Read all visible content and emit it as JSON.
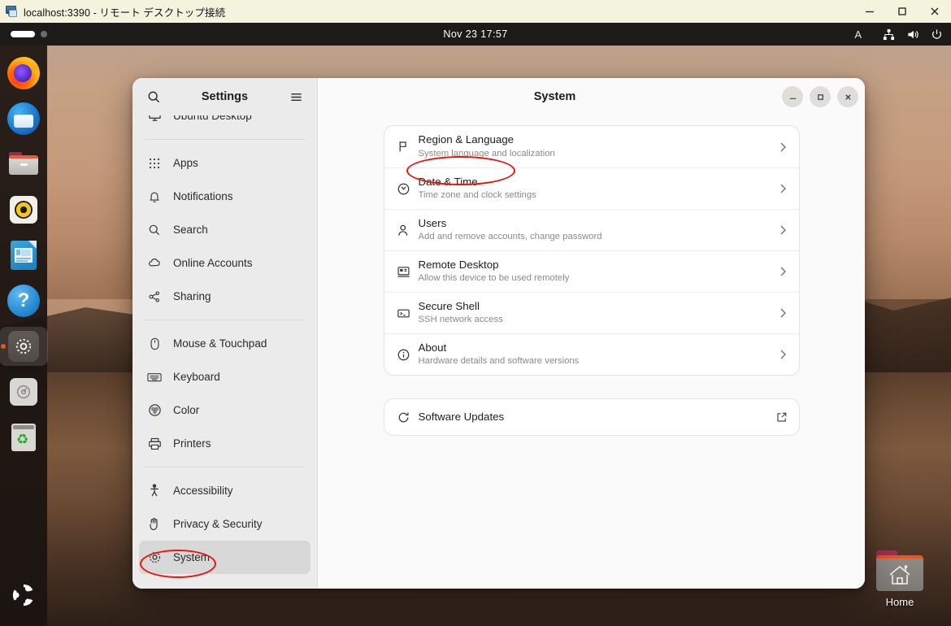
{
  "rdp": {
    "title": "localhost:3390 - リモート デスクトップ接続",
    "icon": "remote-desktop-icon",
    "controls": [
      {
        "name": "minimize",
        "label": "—"
      },
      {
        "name": "maximize",
        "label": "□"
      },
      {
        "name": "close",
        "label": "✕"
      }
    ]
  },
  "topbar": {
    "clock": "Nov 23  17:57",
    "a11y_label": "A",
    "tray_icons": [
      "network-icon",
      "volume-icon",
      "power-icon"
    ]
  },
  "dock": {
    "items": [
      {
        "label": "Firefox",
        "icon": "firefox-icon",
        "active": false
      },
      {
        "label": "Thunderbird Mail",
        "icon": "thunderbird-icon",
        "active": false
      },
      {
        "label": "Files",
        "icon": "files-icon",
        "active": false
      },
      {
        "label": "Rhythmbox",
        "icon": "rhythmbox-icon",
        "active": false
      },
      {
        "label": "LibreOffice Impress",
        "icon": "libreoffice-impress-icon",
        "active": false
      },
      {
        "label": "Help",
        "icon": "help-icon",
        "active": false
      },
      {
        "label": "Settings",
        "icon": "settings-icon",
        "active": true
      },
      {
        "label": "Disk Usage Analyzer",
        "icon": "disk-usage-icon",
        "active": false
      },
      {
        "label": "Trash",
        "icon": "trash-icon",
        "active": false
      }
    ],
    "show_apps_label": "Show Applications",
    "show_apps_icon": "ubuntu-logo-icon"
  },
  "desktop": {
    "home_icon": {
      "label": "Home",
      "icon": "home-folder-icon"
    }
  },
  "settings": {
    "sidebar": {
      "title": "Settings",
      "search_icon": "search-icon",
      "menu_icon": "hamburger-menu-icon",
      "items": [
        {
          "label": "Ubuntu Desktop",
          "icon": "ubuntu-desktop-icon",
          "selected": false,
          "clipped": true
        },
        {
          "label": "Apps",
          "icon": "apps-grid-icon",
          "selected": false
        },
        {
          "label": "Notifications",
          "icon": "bell-icon",
          "selected": false
        },
        {
          "label": "Search",
          "icon": "search-icon",
          "selected": false
        },
        {
          "label": "Online Accounts",
          "icon": "cloud-icon",
          "selected": false
        },
        {
          "label": "Sharing",
          "icon": "share-nodes-icon",
          "selected": false
        },
        {
          "label": "Mouse & Touchpad",
          "icon": "mouse-icon",
          "selected": false
        },
        {
          "label": "Keyboard",
          "icon": "keyboard-icon",
          "selected": false
        },
        {
          "label": "Color",
          "icon": "color-wheel-icon",
          "selected": false
        },
        {
          "label": "Printers",
          "icon": "printer-icon",
          "selected": false
        },
        {
          "label": "Accessibility",
          "icon": "accessibility-person-icon",
          "selected": false
        },
        {
          "label": "Privacy & Security",
          "icon": "hand-shield-icon",
          "selected": false
        },
        {
          "label": "System",
          "icon": "system-gear-icon",
          "selected": true
        }
      ]
    },
    "header": {
      "title": "System",
      "minimize_label": "Minimize",
      "maximize_label": "Maximize",
      "close_label": "Close"
    },
    "main": {
      "rows": [
        {
          "title": "Region & Language",
          "subtitle": "System language and localization",
          "icon": "flag-icon",
          "chevron": "chevron-right-icon"
        },
        {
          "title": "Date & Time",
          "subtitle": "Time zone and clock settings",
          "icon": "clock-icon",
          "chevron": "chevron-right-icon"
        },
        {
          "title": "Users",
          "subtitle": "Add and remove accounts, change password",
          "icon": "user-icon",
          "chevron": "chevron-right-icon"
        },
        {
          "title": "Remote Desktop",
          "subtitle": "Allow this device to be used remotely",
          "icon": "remote-desktop-monitor-icon",
          "chevron": "chevron-right-icon"
        },
        {
          "title": "Secure Shell",
          "subtitle": "SSH network access",
          "icon": "terminal-icon",
          "chevron": "chevron-right-icon"
        },
        {
          "title": "About",
          "subtitle": "Hardware details and software versions",
          "icon": "info-circle-icon",
          "chevron": "chevron-right-icon"
        }
      ],
      "updates_row": {
        "title": "Software Updates",
        "icon": "refresh-icon",
        "action_icon": "external-link-icon"
      }
    }
  },
  "annotations": {
    "accent_color": "#e8140c",
    "marks": [
      {
        "target": "Region & Language",
        "shape": "ellipse"
      },
      {
        "target": "System",
        "shape": "ellipse"
      }
    ]
  }
}
